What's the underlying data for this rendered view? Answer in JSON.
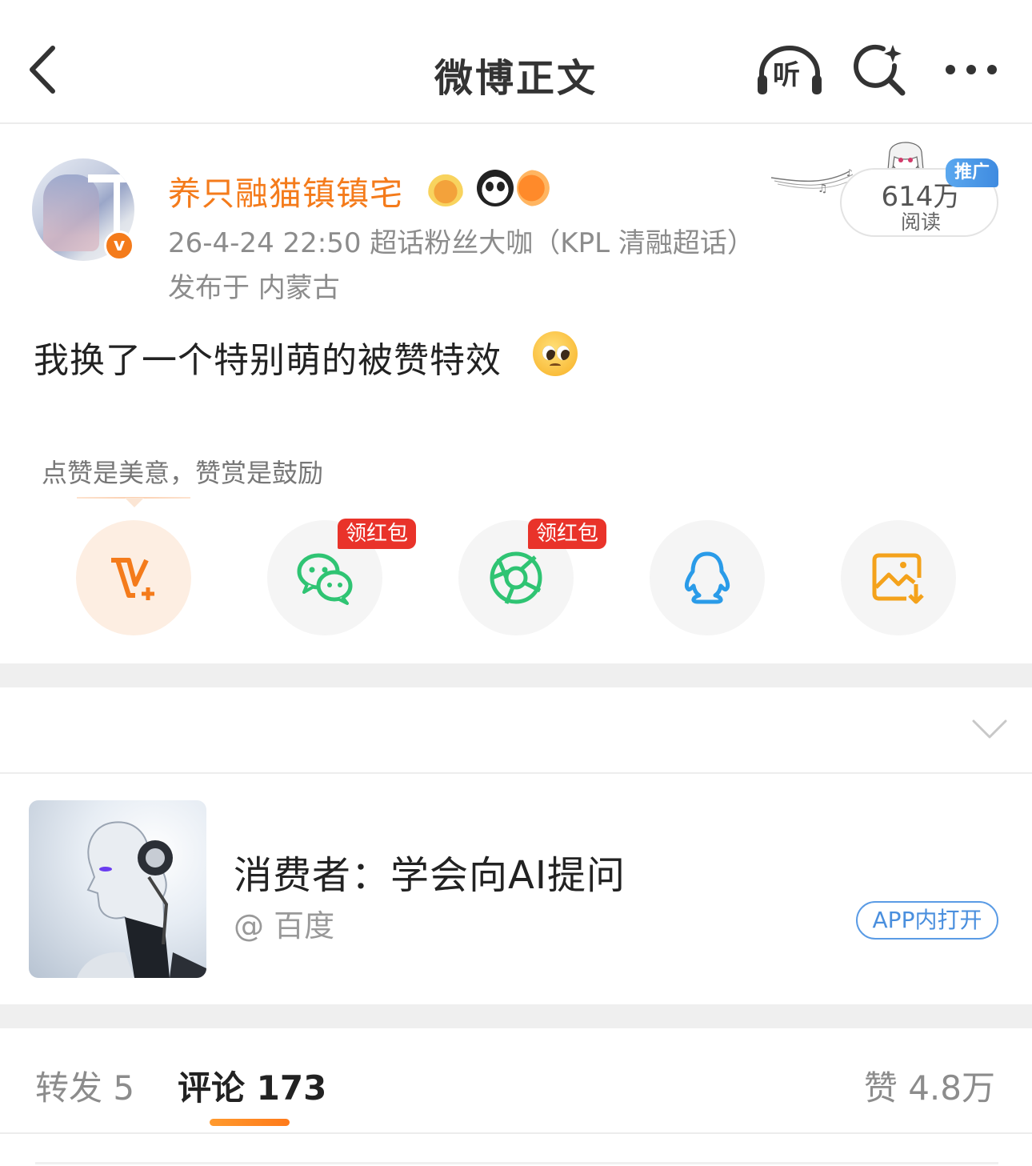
{
  "header": {
    "title": "微博正文",
    "back_icon": "chevron-left-icon",
    "listen_label": "听",
    "search_icon": "search-spark-icon",
    "more_icon": "ellipsis-icon"
  },
  "post": {
    "author": "养只融猫镇镇宅",
    "verified_icon": "v-verified-icon",
    "medals": [
      "crown-medal-icon",
      "panda-medal-icon",
      "fish-medal-icon"
    ],
    "meta": "26-4-24 22:50  超话粉丝大咖（KPL 清融超话）",
    "location": "发布于 内蒙古",
    "reads_count": "614万",
    "reads_label": "阅读",
    "promo_tag": "推广",
    "text": "我换了一个特别萌的被赞特效",
    "emoji": "pleading-face-emoji"
  },
  "share": {
    "tip": "点赞是美意，赞赏是鼓励",
    "items": [
      {
        "name": "vip-plus",
        "icon": "v-plus-icon",
        "color": "#f47b1b"
      },
      {
        "name": "wechat",
        "icon": "wechat-icon",
        "color": "#2fc473",
        "badge": "领红包"
      },
      {
        "name": "moments",
        "icon": "moments-icon",
        "color": "#2fc473",
        "badge": "领红包"
      },
      {
        "name": "qq",
        "icon": "qq-icon",
        "color": "#2a9be8"
      },
      {
        "name": "save-image",
        "icon": "save-image-icon",
        "color": "#f4a21b"
      }
    ]
  },
  "ad": {
    "title": "消费者：学会向AI提问",
    "source": "@ 百度",
    "open_label": "APP内打开"
  },
  "tabs": {
    "repost": "转发 5",
    "comment": "评论 173",
    "like": "赞 4.8万"
  },
  "colors": {
    "accent": "#f47b1b",
    "link": "#4a8fde",
    "redpack": "#e9332a"
  }
}
